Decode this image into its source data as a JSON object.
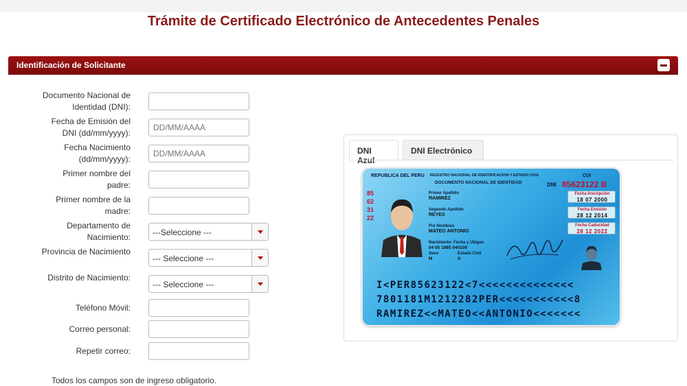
{
  "page": {
    "title": "Trámite de Certificado Electrónico de Antecedentes Penales"
  },
  "section": {
    "title": "Identificación de Solicitante"
  },
  "form": {
    "dni_label": "Documento Nacional de Identidad (DNI):",
    "emision_label": "Fecha de Emisión del DNI (dd/mm/yyyy):",
    "emision_placeholder": "DD/MM/AAAA",
    "nacimiento_label": "Fecha Nacimiento (dd/mm/yyyy):",
    "nacimiento_placeholder": "DD/MM/AAAA",
    "padre_label": "Primer nombre del padre:",
    "madre_label": "Primer nombre de la madre:",
    "departamento_label": "Departamento de Nacimiento:",
    "departamento_value": "---Seleccione ---",
    "provincia_label": "Provincia de Nacimiento",
    "provincia_value": "--- Seleccione ---",
    "distrito_label": "Distrito de Nacimiento:",
    "distrito_value": "--- Seleccione ---",
    "telefono_label": "Teléfono Móvil:",
    "correo_label": "Correo personal:",
    "repetir_label": "Repetir correo:"
  },
  "footnote": "Todos los campos son de ingreso obligatorio.",
  "tabs": [
    {
      "label": "DNI Azul",
      "active": true
    },
    {
      "label": "DNI Electrónico",
      "active": false
    }
  ],
  "dni_card": {
    "republica": "REPUBLICA DEL PERU",
    "registro": "REGISTRO NACIONAL DE IDENTIFICACION Y ESTADO CIVIL",
    "documento": "DOCUMENTO NACIONAL DE IDENTIDAD",
    "dni_label": "DNI",
    "cui_label": "CUI",
    "number": "85623122 B",
    "vertical_number": "85623122",
    "primer_apellido_label": "Primer Apellido",
    "primer_apellido": "RAMIREZ",
    "segundo_apellido_label": "Segundo Apellido",
    "segundo_apellido": "REYES",
    "prenombres_label": "Pre Nombres",
    "prenombres": "MATEO ANTONIO",
    "nacimiento_label": "Nacimiento: Fecha y Ubigeo",
    "nacimiento_value": "04 05 1985     040109",
    "sexo_label": "Sexo",
    "sexo_value": "M",
    "estado_label": "Estado Civil",
    "estado_value": "S",
    "inscripcion_label": "Fecha Inscripción",
    "inscripcion_value": "18 07 2000",
    "emision_label": "Fecha Emisión",
    "emision_value": "28 12 2014",
    "caducidad_label": "Fecha Caducidad",
    "caducidad_value": "28 12 2022",
    "mrz1": "I<PER85623122<7<<<<<<<<<<<<<<",
    "mrz2": "7801181M1212282PER<<<<<<<<<<<8",
    "mrz3": "RAMIREZ<<MATEO<<ANTONIO<<<<<<<"
  },
  "colors": {
    "brand": "#8b1a1a",
    "bar": "#9d1212",
    "card": "#3fb0e6"
  }
}
